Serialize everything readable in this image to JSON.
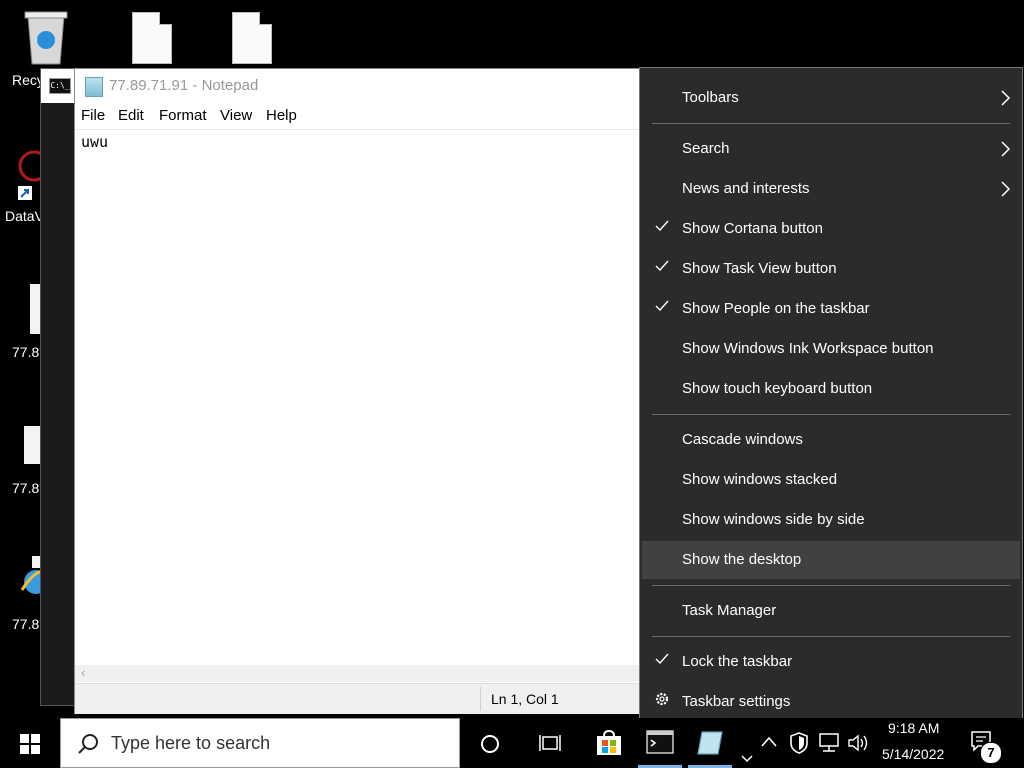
{
  "desktop": {
    "icons": [
      {
        "label": "Recy"
      },
      {
        "label": "DataV"
      },
      {
        "label": "77.8"
      },
      {
        "label": "77.8"
      },
      {
        "label": "77.8"
      }
    ]
  },
  "cmd": {
    "icon_text": "C:\\_"
  },
  "notepad": {
    "title": "77.89.71.91 - Notepad",
    "menu": [
      "File",
      "Edit",
      "Format",
      "View",
      "Help"
    ],
    "content": "uwu",
    "status": "Ln 1, Col 1"
  },
  "context_menu": {
    "items": [
      {
        "label": "Toolbars",
        "submenu": true,
        "checked": false
      },
      {
        "label": "Search",
        "submenu": true,
        "checked": false
      },
      {
        "label": "News and interests",
        "submenu": true,
        "checked": false
      },
      {
        "label": "Show Cortana button",
        "submenu": false,
        "checked": true
      },
      {
        "label": "Show Task View button",
        "submenu": false,
        "checked": true
      },
      {
        "label": "Show People on the taskbar",
        "submenu": false,
        "checked": true
      },
      {
        "label": "Show Windows Ink Workspace button",
        "submenu": false,
        "checked": false
      },
      {
        "label": "Show touch keyboard button",
        "submenu": false,
        "checked": false
      },
      {
        "label": "Cascade windows",
        "submenu": false,
        "checked": false
      },
      {
        "label": "Show windows stacked",
        "submenu": false,
        "checked": false
      },
      {
        "label": "Show windows side by side",
        "submenu": false,
        "checked": false
      },
      {
        "label": "Show the desktop",
        "submenu": false,
        "checked": false,
        "highlighted": true
      },
      {
        "label": "Task Manager",
        "submenu": false,
        "checked": false
      },
      {
        "label": "Lock the taskbar",
        "submenu": false,
        "checked": true
      },
      {
        "label": "Taskbar settings",
        "submenu": false,
        "checked": false,
        "icon": "gear-icon"
      }
    ]
  },
  "taskbar": {
    "search_placeholder": "Type here to search",
    "time": "9:18 AM",
    "date": "5/14/2022",
    "notification_count": "7"
  },
  "colors": {
    "menu_bg": "#2b2b2b",
    "menu_highlight": "#414141",
    "taskbar_bg": "#000000",
    "accent": "#7fb2e5"
  }
}
